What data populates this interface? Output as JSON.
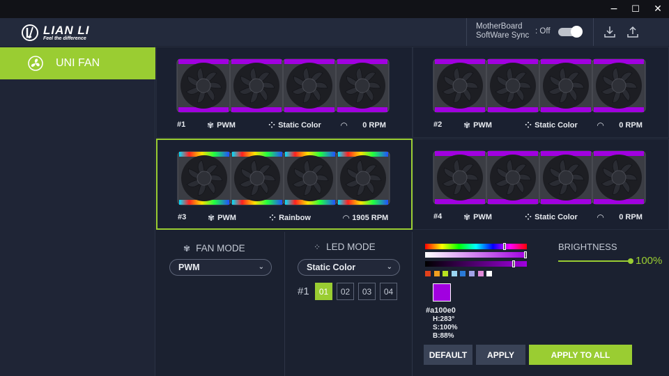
{
  "window": {
    "minimize": "−",
    "maximize": "☐",
    "close": "✕"
  },
  "brand": {
    "name": "LIAN LI",
    "tagline": "Feel the difference"
  },
  "header": {
    "sync_label_1": "MotherBoard",
    "sync_label_2": "SoftWare Sync",
    "sync_state": ": Off",
    "sync_on": false
  },
  "sidebar": {
    "items": [
      {
        "label": "UNI FAN",
        "selected": true
      }
    ]
  },
  "fan_groups": [
    {
      "id": "#1",
      "fan_mode": "PWM",
      "led_mode": "Static Color",
      "speed": "0 RPM",
      "lighting": "purple",
      "selected": false
    },
    {
      "id": "#2",
      "fan_mode": "PWM",
      "led_mode": "Static Color",
      "speed": "0 RPM",
      "lighting": "purple",
      "selected": false
    },
    {
      "id": "#3",
      "fan_mode": "PWM",
      "led_mode": "Rainbow",
      "speed": "1905 RPM",
      "lighting": "rainbow",
      "selected": true
    },
    {
      "id": "#4",
      "fan_mode": "PWM",
      "led_mode": "Static Color",
      "speed": "0 RPM",
      "lighting": "purple",
      "selected": false
    }
  ],
  "fan_mode": {
    "title": "FAN MODE",
    "value": "PWM"
  },
  "led_mode": {
    "title": "LED MODE",
    "value": "Static Color",
    "group_label": "#1",
    "fans": [
      {
        "label": "01",
        "active": true
      },
      {
        "label": "02",
        "active": false
      },
      {
        "label": "03",
        "active": false
      },
      {
        "label": "04",
        "active": false
      }
    ]
  },
  "color": {
    "hex": "#a100e0",
    "h": "H:283°",
    "s": "S:100%",
    "b": "B:88%",
    "value": "#a100e0",
    "swatches": [
      "#e2401a",
      "#f0a020",
      "#b8e020",
      "#9ad4f0",
      "#2a7ad8",
      "#a2a2e8",
      "#e08ad8",
      "#ffffff"
    ],
    "hue_marker": 0.79,
    "sat_marker": 1.0,
    "bri_marker": 0.88
  },
  "brightness": {
    "title": "BRIGHTNESS",
    "value": "100%",
    "level": 1.0
  },
  "buttons": {
    "default": "DEFAULT",
    "apply": "APPLY",
    "apply_all": "APPLY TO ALL"
  },
  "colors": {
    "accent": "#9acd32",
    "purple_ring": "#a100e0",
    "background": "#1b2130"
  }
}
